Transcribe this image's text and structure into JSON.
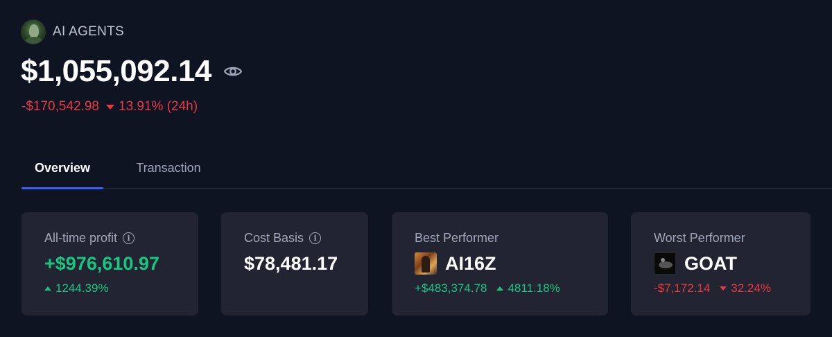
{
  "portfolio": {
    "name": "AI AGENTS",
    "balance": "$1,055,092.14",
    "change_amount": "-$170,542.98",
    "change_percent": "13.91% (24h)",
    "avatar_icon": "avatar-image",
    "visibility_icon": "eye-icon"
  },
  "tabs": [
    {
      "label": "Overview",
      "active": true
    },
    {
      "label": "Transaction",
      "active": false
    }
  ],
  "cards": {
    "all_time_profit": {
      "label": "All-time profit",
      "value": "+$976,610.97",
      "change": "1244.39%",
      "trend": "up"
    },
    "cost_basis": {
      "label": "Cost Basis",
      "value": "$78,481.17"
    },
    "best_performer": {
      "label": "Best Performer",
      "token": "AI16Z",
      "profit": "+$483,374.78",
      "change": "4811.18%",
      "trend": "up"
    },
    "worst_performer": {
      "label": "Worst Performer",
      "token": "GOAT",
      "profit": "-$7,172.14",
      "change": "32.24%",
      "trend": "down"
    }
  },
  "colors": {
    "background": "#0e1421",
    "card_background": "#222531",
    "positive": "#16c784",
    "negative": "#ea3943",
    "accent": "#3861fb",
    "muted_text": "#a1a7bb"
  }
}
